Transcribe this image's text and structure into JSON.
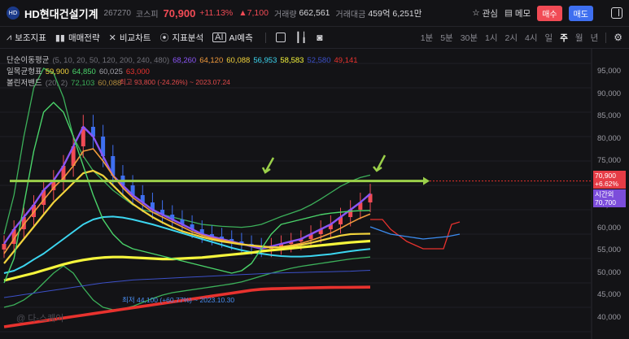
{
  "header": {
    "logo_text": "HD",
    "company_name": "HD현대건설기계",
    "code": "267270",
    "market": "코스피",
    "price": "70,900",
    "change_pct": "+11.13%",
    "change_abs": "▲7,100",
    "volume_label": "거래량",
    "volume": "662,561",
    "amount_label": "거래대금",
    "amount": "459억 6,251만",
    "watch_label": "관심",
    "memo_label": "메모",
    "buy_label": "매수",
    "sell_label": "매도"
  },
  "toolbar": {
    "items": [
      {
        "label": "보조지표",
        "icon": "indicator-icon"
      },
      {
        "label": "매매전략",
        "icon": "strategy-icon"
      },
      {
        "label": "비교차트",
        "icon": "compare-icon"
      },
      {
        "label": "지표분석",
        "icon": "analysis-icon"
      },
      {
        "label": "AI예측",
        "icon": "ai-icon"
      }
    ],
    "periods": [
      "1분",
      "5분",
      "30분",
      "1시",
      "2시",
      "4시",
      "일",
      "주",
      "월",
      "년"
    ],
    "active_period": "주"
  },
  "legend": {
    "ma": {
      "name": "단순이동평균",
      "params": "(5, 10, 20, 50, 120, 200, 240, 480)",
      "values": [
        {
          "v": "68,260",
          "color": "#8a55f5"
        },
        {
          "v": "64,120",
          "color": "#f29a3c"
        },
        {
          "v": "60,088",
          "color": "#f2d33c"
        },
        {
          "v": "56,953",
          "color": "#3cd6f0"
        },
        {
          "v": "58,583",
          "color": "#f5f53c"
        },
        {
          "v": "52,580",
          "color": "#3c50c8"
        },
        {
          "v": "49,141",
          "color": "#e8322e"
        }
      ]
    },
    "ichimoku": {
      "name": "일목균형표",
      "values": [
        {
          "v": "59,900",
          "color": "#f2d33c"
        },
        {
          "v": "64,850",
          "color": "#4ad46a"
        },
        {
          "v": "60,025",
          "color": "#a0a0a8"
        },
        {
          "v": "63,000",
          "color": "#e8322e"
        }
      ]
    },
    "bollinger": {
      "name": "볼린저밴드",
      "params": "(20, 2)",
      "values": [
        {
          "v": "72,103",
          "color": "#3cb05a"
        },
        {
          "v": "60,088",
          "color": "#b08a3c"
        }
      ]
    }
  },
  "annotations": {
    "high": "최고 93,800 (-24.26%) ~ 2023.07.24",
    "low": "최저 44,100 (+60.77%) ~ 2023.10.30"
  },
  "watermark": "@ 다-스퀘어",
  "price_tag": {
    "price": "70,900",
    "pct": "+6.62%"
  },
  "time_tag": {
    "label": "시간외",
    "price": "70,700"
  },
  "colors": {
    "up": "#f14b55",
    "down": "#3e6ff0",
    "bg": "#131316"
  },
  "chart_data": {
    "type": "line",
    "title": "",
    "yticks": [
      95000,
      90000,
      85000,
      80000,
      75000,
      70000,
      65000,
      60000,
      55000,
      50000,
      45000,
      40000
    ],
    "ylim": [
      38500,
      98000
    ],
    "series": [
      {
        "color": "#8a55f5",
        "values": [
          58000,
          61000,
          63500,
          66000,
          69000,
          71000,
          74000,
          78000,
          82000,
          80000,
          76000,
          72000,
          70000,
          68000,
          66500,
          65000,
          64000,
          63000,
          62000,
          61000,
          60000,
          59500,
          59000,
          58500,
          58000,
          57500,
          57000,
          57500,
          58000,
          58500,
          59000,
          60000,
          61000,
          62000,
          63500,
          65000,
          66500,
          68260
        ]
      },
      {
        "color": "#f29a3c",
        "values": [
          56000,
          59000,
          62000,
          64500,
          67000,
          69500,
          71500,
          74000,
          77000,
          77500,
          75000,
          72000,
          69500,
          67500,
          66000,
          64500,
          63500,
          62500,
          61500,
          60500,
          59800,
          59200,
          58800,
          58400,
          58000,
          57600,
          57400,
          57200,
          57400,
          57700,
          58100,
          58700,
          59400,
          60200,
          61200,
          62300,
          63300,
          64120
        ]
      },
      {
        "color": "#f2d33c",
        "values": [
          54000,
          56500,
          59000,
          61500,
          64000,
          66500,
          68500,
          70500,
          72500,
          73000,
          72000,
          70000,
          68000,
          66200,
          64800,
          63500,
          62400,
          61400,
          60600,
          60000,
          59400,
          58900,
          58500,
          58200,
          57900,
          57700,
          57500,
          57300,
          57300,
          57500,
          57800,
          58200,
          58700,
          59200,
          59700,
          60000,
          60050,
          60088
        ]
      },
      {
        "color": "#3cd6f0",
        "values": [
          52000,
          52500,
          53500,
          54800,
          56000,
          57500,
          59000,
          60500,
          62000,
          63000,
          63500,
          63600,
          63400,
          63000,
          62500,
          62000,
          61400,
          60800,
          60200,
          59600,
          59000,
          58400,
          57800,
          57200,
          56700,
          56300,
          56000,
          55700,
          55500,
          55400,
          55400,
          55500,
          55700,
          55900,
          56200,
          56500,
          56750,
          56953
        ]
      },
      {
        "color": "#f5f53c",
        "values": [
          50500,
          51000,
          51500,
          52000,
          52600,
          53200,
          53800,
          54300,
          54700,
          55000,
          55200,
          55300,
          55300,
          55200,
          55100,
          55000,
          54900,
          54900,
          55000,
          55100,
          55200,
          55400,
          55600,
          55800,
          56000,
          56200,
          56500,
          56700,
          56900,
          57100,
          57300,
          57500,
          57700,
          57900,
          58100,
          58300,
          58450,
          58583
        ]
      },
      {
        "color": "#3c50c8",
        "values": [
          47000,
          47300,
          47600,
          47900,
          48200,
          48500,
          48800,
          49100,
          49400,
          49700,
          50000,
          50200,
          50400,
          50600,
          50700,
          50800,
          50900,
          51000,
          51100,
          51200,
          51300,
          51400,
          51500,
          51600,
          51700,
          51800,
          51900,
          52000,
          52050,
          52100,
          52150,
          52200,
          52250,
          52300,
          52350,
          52400,
          52500,
          52580
        ]
      },
      {
        "color": "#e8322e",
        "values": [
          41000,
          41300,
          41600,
          41900,
          42200,
          42500,
          42800,
          43100,
          43400,
          43700,
          44000,
          44300,
          44600,
          44900,
          45200,
          45500,
          45800,
          46100,
          46400,
          46700,
          47000,
          47300,
          47600,
          47900,
          48200,
          48500,
          48700,
          48800,
          48850,
          48900,
          48950,
          49000,
          49030,
          49060,
          49080,
          49100,
          49120,
          49141
        ]
      },
      {
        "color": "#4ad46a",
        "values": [
          50000,
          55000,
          66000,
          77000,
          85000,
          87000,
          85000,
          80000,
          74000,
          68000,
          63000,
          60000,
          58000,
          57000,
          56500,
          56000,
          55500,
          55000,
          54500,
          54000,
          53500,
          53000,
          52500,
          52000,
          52500,
          54000,
          57000,
          60000,
          62000,
          62500,
          63000,
          63500,
          64000,
          64300,
          64500,
          64700,
          64800,
          64850
        ]
      }
    ],
    "bollinger_upper": [
      60000,
      68000,
      80000,
      90000,
      94000,
      93000,
      88000,
      80000,
      76000,
      73000,
      71000,
      69000,
      67500,
      66000,
      65000,
      64500,
      64000,
      63500,
      63000,
      62500,
      62000,
      61800,
      61600,
      61500,
      61400,
      61600,
      62000,
      62800,
      63600,
      64300,
      65000,
      66000,
      67200,
      68500,
      69800,
      70800,
      71600,
      72103
    ],
    "bollinger_lower": [
      45000,
      45500,
      46500,
      48000,
      50000,
      52000,
      53500,
      52000,
      49000,
      46500,
      45000,
      44500,
      44700,
      45200,
      46000,
      46800,
      47500,
      48000,
      48300,
      48600,
      48900,
      49200,
      49500,
      49800,
      50200,
      50800,
      51400,
      52000,
      52500,
      53000,
      53400,
      53700,
      54000,
      54300,
      54600,
      54900,
      55100,
      55300
    ]
  }
}
